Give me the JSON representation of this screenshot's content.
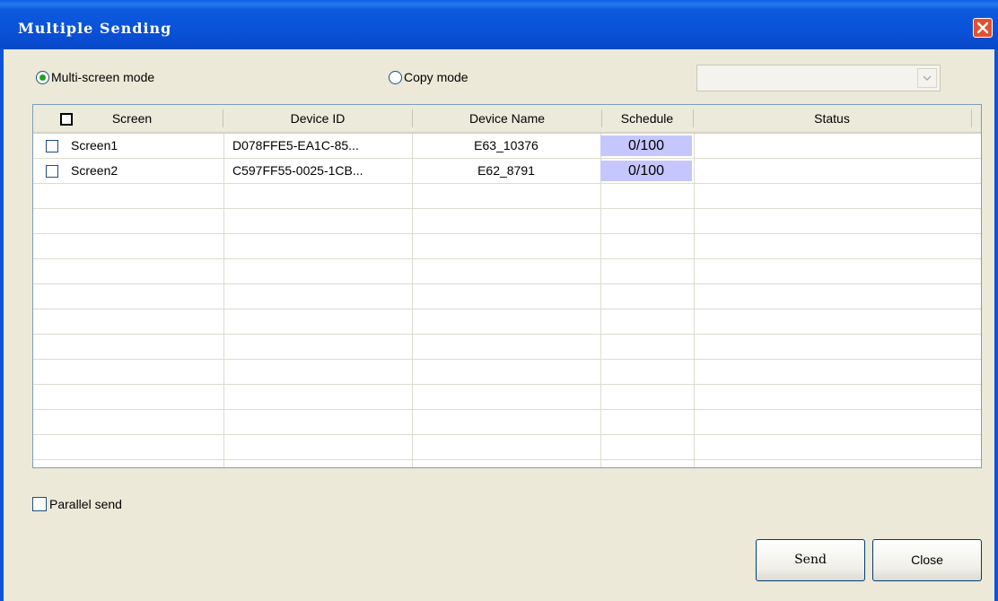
{
  "window": {
    "title": "Multiple Sending"
  },
  "modes": {
    "multi_screen": {
      "label": "Multi-screen mode",
      "selected": true
    },
    "copy": {
      "label": "Copy mode",
      "selected": false
    },
    "dropdown_value": ""
  },
  "table": {
    "columns": [
      "Screen",
      "Device ID",
      "Device Name",
      "Schedule",
      "Status"
    ],
    "rows": [
      {
        "screen": "Screen1",
        "device_id": "D078FFE5-EA1C-85...",
        "device_name": "E63_10376",
        "schedule": "0/100",
        "status": ""
      },
      {
        "screen": "Screen2",
        "device_id": "C597FF55-0025-1CB...",
        "device_name": "E62_8791",
        "schedule": "0/100",
        "status": ""
      }
    ]
  },
  "options": {
    "parallel_send": {
      "label": "Parallel send",
      "checked": false
    }
  },
  "buttons": {
    "send": "Send",
    "close": "Close"
  },
  "colors": {
    "title_bar": "#0a52d8",
    "schedule_fill": "#c6c6ff",
    "radio_dot": "#21a121",
    "close_button": "#e4502f"
  },
  "icons": {
    "close": "close-icon",
    "dropdown": "chevron-down-icon"
  }
}
